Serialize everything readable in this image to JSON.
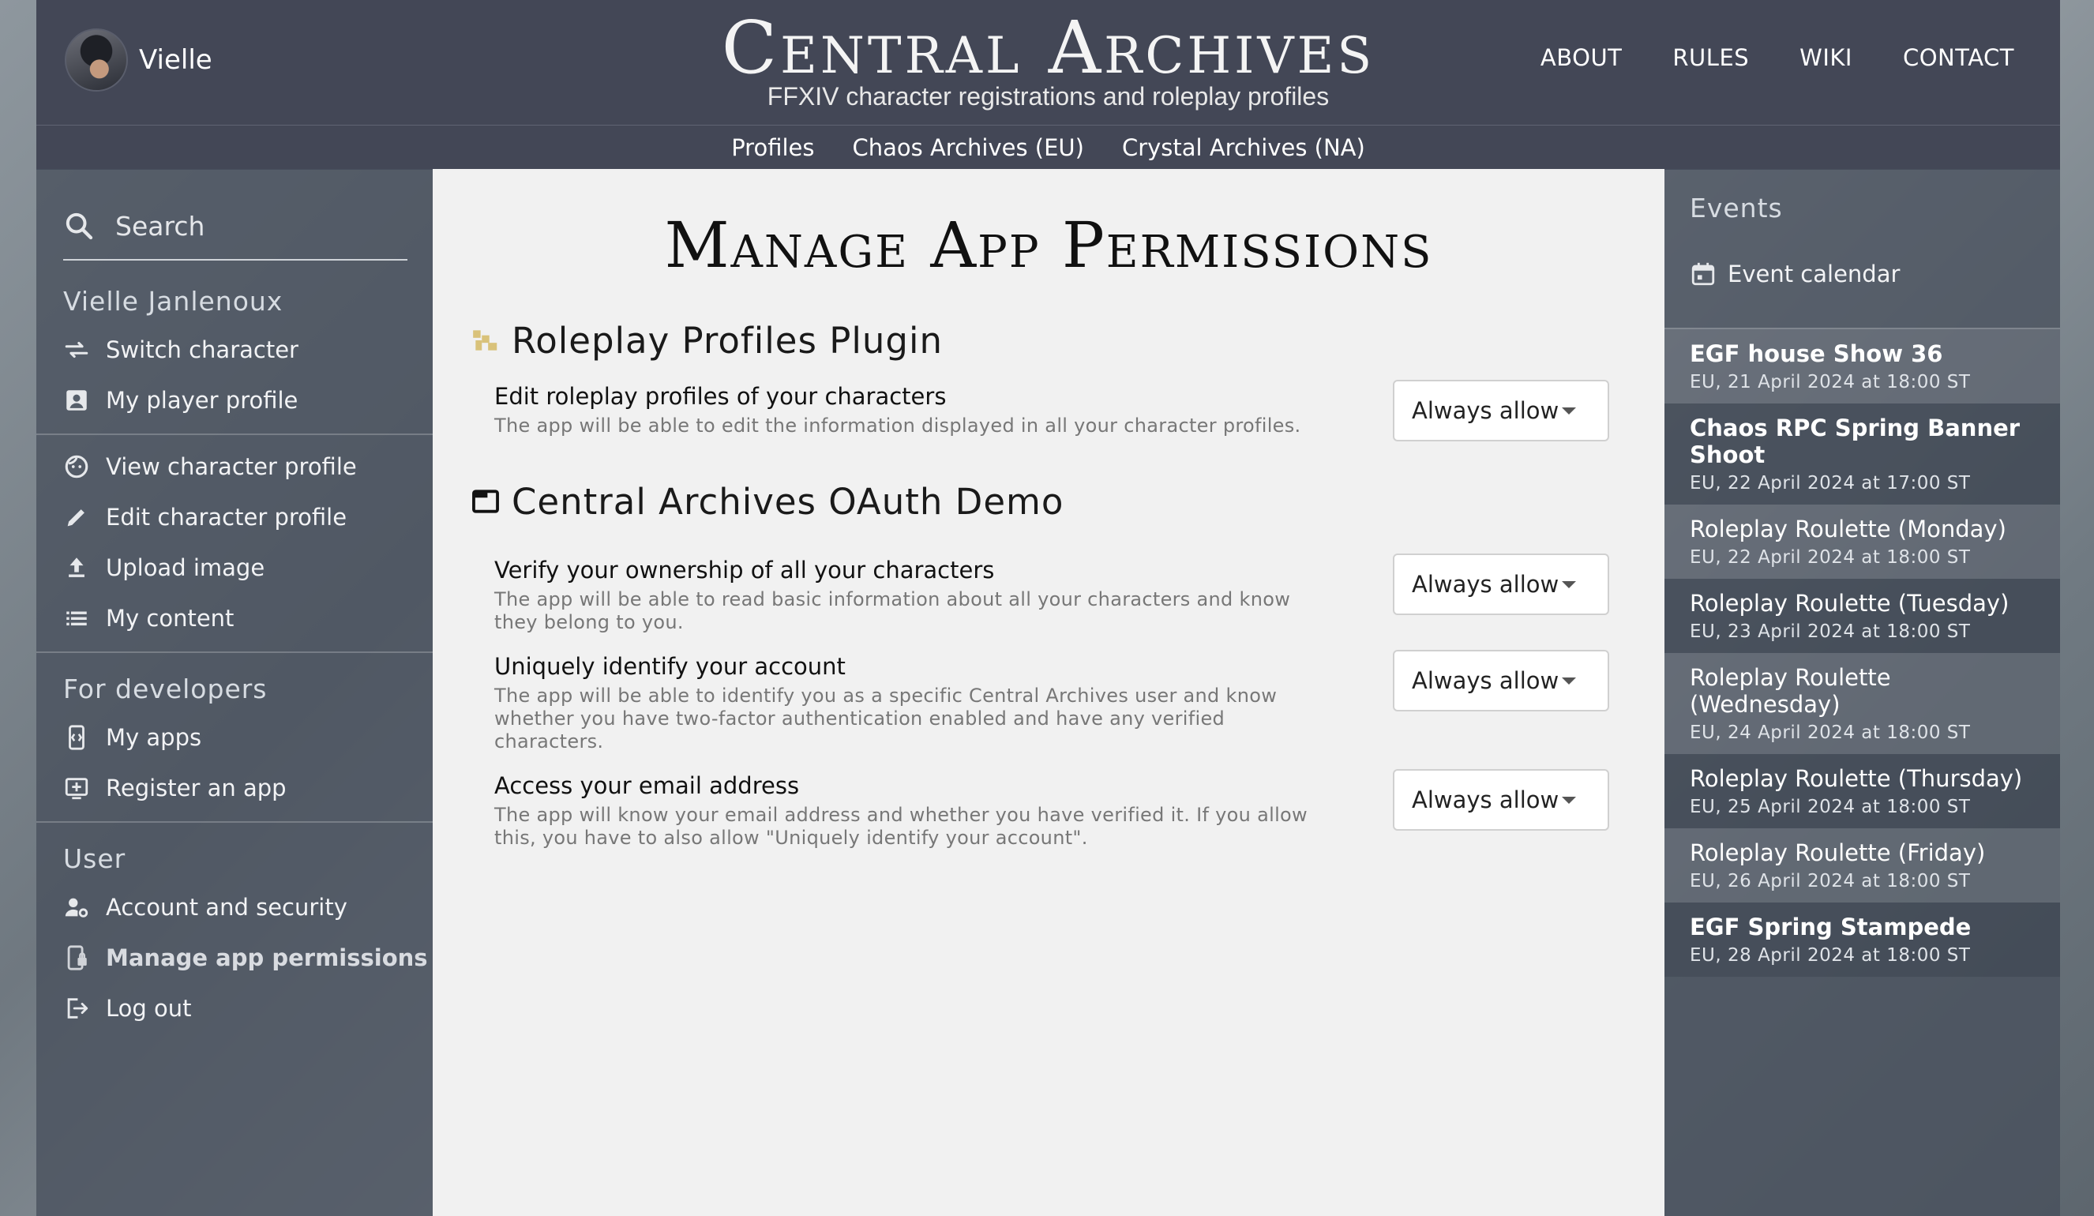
{
  "header": {
    "user_name": "Vielle",
    "brand_title": "Central Archives",
    "brand_subtitle": "FFXIV character registrations and roleplay profiles",
    "nav": [
      "ABOUT",
      "RULES",
      "WIKI",
      "CONTACT"
    ]
  },
  "subnav": [
    "Profiles",
    "Chaos Archives (EU)",
    "Crystal Archives (NA)"
  ],
  "sidebar": {
    "search_placeholder": "Search",
    "character_heading": "Vielle Janlenoux",
    "character_items": [
      {
        "label": "Switch character",
        "icon": "swap-icon"
      },
      {
        "label": "My player profile",
        "icon": "account-box-icon"
      }
    ],
    "profile_items": [
      {
        "label": "View character profile",
        "icon": "face-icon"
      },
      {
        "label": "Edit character profile",
        "icon": "pencil-icon"
      },
      {
        "label": "Upload image",
        "icon": "upload-icon"
      },
      {
        "label": "My content",
        "icon": "list-icon"
      }
    ],
    "dev_heading": "For developers",
    "dev_items": [
      {
        "label": "My apps",
        "icon": "phone-code-icon"
      },
      {
        "label": "Register an app",
        "icon": "add-box-icon"
      }
    ],
    "user_heading": "User",
    "user_items": [
      {
        "label": "Account and security",
        "icon": "account-gear-icon"
      },
      {
        "label": "Manage app permissions",
        "icon": "phone-lock-icon"
      },
      {
        "label": "Log out",
        "icon": "logout-icon"
      }
    ]
  },
  "main": {
    "title": "Manage App Permissions",
    "apps": [
      {
        "name": "Roleplay Profiles Plugin",
        "icon": "plugin-logo-icon",
        "permissions": [
          {
            "title": "Edit roleplay profiles of your characters",
            "description": "The app will be able to edit the information displayed in all your character profiles.",
            "value": "Always allow"
          }
        ]
      },
      {
        "name": "Central Archives OAuth Demo",
        "icon": "window-icon",
        "permissions": [
          {
            "title": "Verify your ownership of all your characters",
            "description": "The app will be able to read basic information about all your characters and know they belong to you.",
            "value": "Always allow"
          },
          {
            "title": "Uniquely identify your account",
            "description": "The app will be able to identify you as a specific Central Archives user and know whether you have two-factor authentication enabled and have any verified characters.",
            "value": "Always allow"
          },
          {
            "title": "Access your email address",
            "description": "The app will know your email address and whether you have verified it. If you allow this, you have to also allow \"Uniquely identify your account\".",
            "value": "Always allow"
          }
        ]
      }
    ]
  },
  "events": {
    "heading": "Events",
    "calendar_label": "Event calendar",
    "list": [
      {
        "title": "EGF house Show 36",
        "date": "EU, 21 April 2024 at 18:00 ST",
        "bold": true
      },
      {
        "title": "Chaos RPC Spring Banner Shoot",
        "date": "EU, 22 April 2024 at 17:00 ST",
        "bold": true
      },
      {
        "title": "Roleplay Roulette (Monday)",
        "date": "EU, 22 April 2024 at 18:00 ST",
        "bold": false
      },
      {
        "title": "Roleplay Roulette (Tuesday)",
        "date": "EU, 23 April 2024 at 18:00 ST",
        "bold": false
      },
      {
        "title": "Roleplay Roulette (Wednesday)",
        "date": "EU, 24 April 2024 at 18:00 ST",
        "bold": false
      },
      {
        "title": "Roleplay Roulette (Thursday)",
        "date": "EU, 25 April 2024 at 18:00 ST",
        "bold": false
      },
      {
        "title": "Roleplay Roulette (Friday)",
        "date": "EU, 26 April 2024 at 18:00 ST",
        "bold": false
      },
      {
        "title": "EGF Spring Stampede",
        "date": "EU, 28 April 2024 at 18:00 ST",
        "bold": true
      }
    ]
  },
  "colors": {
    "header_bg": "#434756",
    "main_bg": "#f1f1f1",
    "panel_bg": "#48505c"
  }
}
